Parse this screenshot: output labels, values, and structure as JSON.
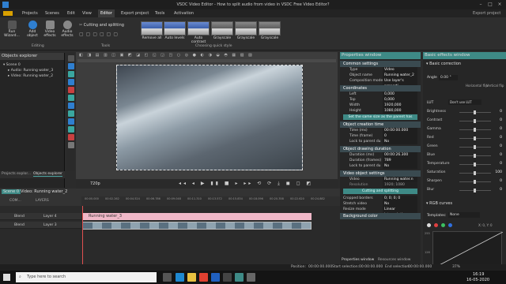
{
  "app": {
    "title": "VSDC Video Editor - How to split audio from video in VSDC Free Video Editor?",
    "export_label": "Export project"
  },
  "menu": [
    "Projects",
    "Scenes",
    "Edit",
    "View",
    "Editor",
    "Export project",
    "Tools",
    "Activation"
  ],
  "menu_active": "Editor",
  "ribbon": {
    "buttons": [
      {
        "label": "Run Wizard...",
        "name": "run-wizard"
      },
      {
        "label": "Add object",
        "name": "add-object"
      },
      {
        "label": "Video effects",
        "name": "video-effects"
      },
      {
        "label": "Audio effects",
        "name": "audio-effects"
      }
    ],
    "cutting": "Cutting and splitting",
    "groups": {
      "editing": "Editing",
      "tools": "Tools",
      "quick_style": "Choosing quick style"
    },
    "styles": [
      "Remove all",
      "Auto levels",
      "Auto contrast",
      "Grayscale",
      "Grayscale",
      "Grayscale"
    ]
  },
  "objects_explorer": {
    "title": "Objects explorer",
    "tree": [
      "Scene 0",
      "Audio: Running water_3",
      "Video: Running water_2"
    ],
    "tabs": [
      "Projects explor...",
      "Objects explorer"
    ]
  },
  "player": {
    "zoom": "720p"
  },
  "timeline": {
    "breadcrumb": [
      "Scene 0",
      "Video: Running water_2"
    ],
    "header": "COM...",
    "layers_label": "LAYERS",
    "layers": [
      {
        "blend": "Blend",
        "name": "Layer 4"
      },
      {
        "blend": "Blend",
        "name": "Layer 3"
      }
    ],
    "audio_clip": "Running water_3",
    "ruler": [
      "00:00.000",
      "00:02.262",
      "00:04.524",
      "00:06.786",
      "00:09.048",
      "00:11.310",
      "00:13.572",
      "00:15.834",
      "00:18.096",
      "00:20.358",
      "00:22.620",
      "00:24.882"
    ]
  },
  "properties": {
    "title": "Properties window",
    "sections": {
      "common": "Common settings",
      "coords": "Coordinates",
      "creation": "Object creation time",
      "drawing": "Object drawing duration",
      "video": "Video object settings",
      "background": "Background color"
    },
    "common": [
      {
        "k": "Type",
        "v": "Video"
      },
      {
        "k": "Object name",
        "v": "Running water_2"
      },
      {
        "k": "Composition mode",
        "v": "Use layer's properti"
      }
    ],
    "coords": [
      {
        "k": "Left",
        "v": "0,000"
      },
      {
        "k": "Top",
        "v": "0,000"
      },
      {
        "k": "Width",
        "v": "1920,000"
      },
      {
        "k": "Height",
        "v": "1080,000"
      }
    ],
    "same_size": "Set the same size as the parent has",
    "creation": [
      {
        "k": "Time (ms)",
        "v": "00:00:00.000"
      },
      {
        "k": "Time (frame)",
        "v": "0"
      },
      {
        "k": "Lock to parent du",
        "v": "No"
      }
    ],
    "drawing": [
      {
        "k": "Duration (ms)",
        "v": "00:00:26.300"
      },
      {
        "k": "Duration (frames)",
        "v": "789"
      },
      {
        "k": "Lock to parent du",
        "v": "No"
      }
    ],
    "video": [
      {
        "k": "Video",
        "v": "Running water.n"
      },
      {
        "k": "Resolution",
        "v": "1920; 1080"
      }
    ],
    "cutting_btn": "Cutting and splitting",
    "video2": [
      {
        "k": "Cropped borders",
        "v": "0; 0; 0; 0"
      },
      {
        "k": "Stretch video",
        "v": "No"
      },
      {
        "k": "Resize mode",
        "v": "Linear interpolation"
      }
    ],
    "tabs": [
      "Properties window",
      "Resources window"
    ]
  },
  "effects": {
    "title": "Basic effects window",
    "basic": "Basic correction",
    "angle_label": "Angle",
    "angle": "0.00 °",
    "flip_h": "Horizontal flip",
    "flip_v": "Vertical flip",
    "lut_label": "LUT",
    "lut": "Don't use LUT",
    "rows": [
      {
        "k": "Brightness",
        "v": "0"
      },
      {
        "k": "Contrast",
        "v": "0"
      },
      {
        "k": "Gamma",
        "v": "0"
      },
      {
        "k": "Red",
        "v": "0"
      },
      {
        "k": "Green",
        "v": "0"
      },
      {
        "k": "Blue",
        "v": "0"
      },
      {
        "k": "Temperature",
        "v": "0"
      },
      {
        "k": "Saturation",
        "v": "100"
      },
      {
        "k": "Sharpen",
        "v": "0"
      },
      {
        "k": "Blur",
        "v": "0"
      }
    ],
    "rgb": "RGB curves",
    "templates_label": "Templates:",
    "templates": "None",
    "coord": "X: 0, Y: 0",
    "curve_top": "255",
    "curve_bottom": "128"
  },
  "status": {
    "position_label": "Position:",
    "position": "00:00:00.000",
    "start_label": "Start selection:",
    "start": "00:00:00.000",
    "end_label": "End selection:",
    "end": "00:00:00.000",
    "zoom": "37%"
  },
  "taskbar": {
    "search": "Type here to search",
    "time": "16:19",
    "date": "16-05-2020"
  }
}
